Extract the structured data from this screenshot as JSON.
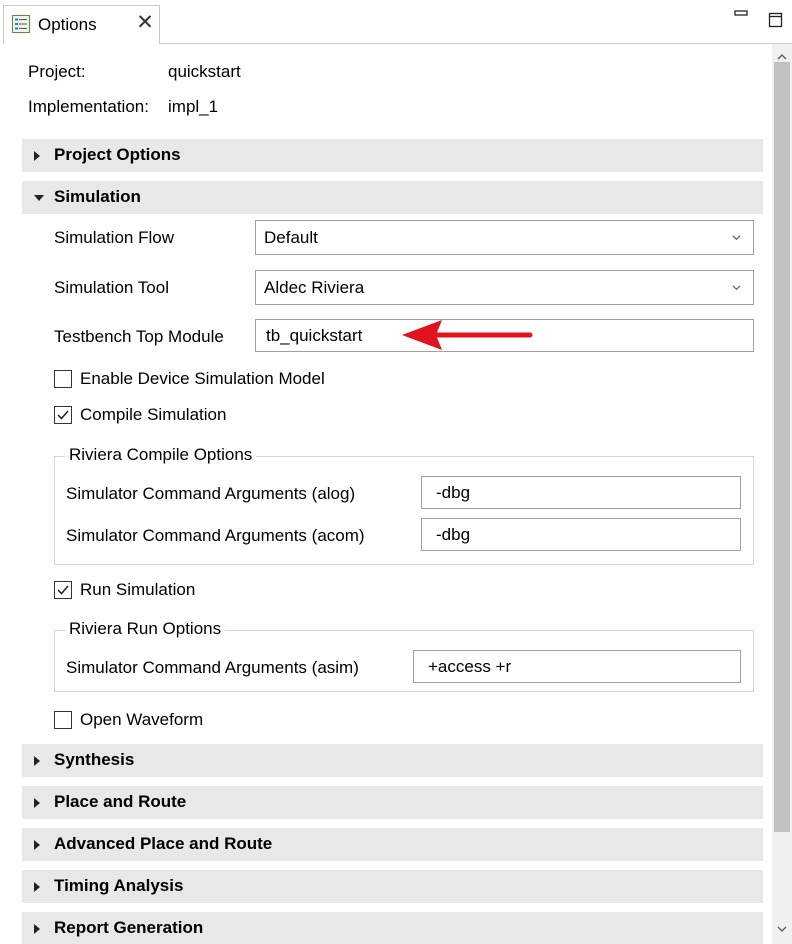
{
  "tab": {
    "label": "Options",
    "close_glyph": "✕",
    "icon": "options-list-icon"
  },
  "window": {
    "minimize_icon": "minimize-icon",
    "maximize_icon": "maximize-icon"
  },
  "info": {
    "project_label": "Project:",
    "project_value": "quickstart",
    "implementation_label": "Implementation:",
    "implementation_value": "impl_1"
  },
  "sections": {
    "project_options": "Project Options",
    "simulation": "Simulation",
    "synthesis": "Synthesis",
    "place_and_route": "Place and Route",
    "advanced_place_and_route": "Advanced Place and Route",
    "timing_analysis": "Timing Analysis",
    "report_generation": "Report Generation"
  },
  "simulation": {
    "flow_label": "Simulation Flow",
    "flow_value": "Default",
    "tool_label": "Simulation Tool",
    "tool_value": "Aldec Riviera",
    "testbench_label": "Testbench Top Module",
    "testbench_value": "tb_quickstart",
    "enable_device_model_label": "Enable Device Simulation Model",
    "enable_device_model_checked": false,
    "compile_label": "Compile Simulation",
    "compile_checked": true,
    "compile_group_title": "Riviera Compile Options",
    "alog_label": "Simulator Command Arguments (alog)",
    "alog_value": "-dbg",
    "acom_label": "Simulator Command Arguments (acom)",
    "acom_value": "-dbg",
    "run_label": "Run Simulation",
    "run_checked": true,
    "run_group_title": "Riviera Run Options",
    "asim_label": "Simulator Command Arguments (asim)",
    "asim_value": "+access +r",
    "open_waveform_label": "Open Waveform",
    "open_waveform_checked": false
  },
  "colors": {
    "annotation_arrow": "#e0141e",
    "section_bg": "#e8e8e8"
  }
}
